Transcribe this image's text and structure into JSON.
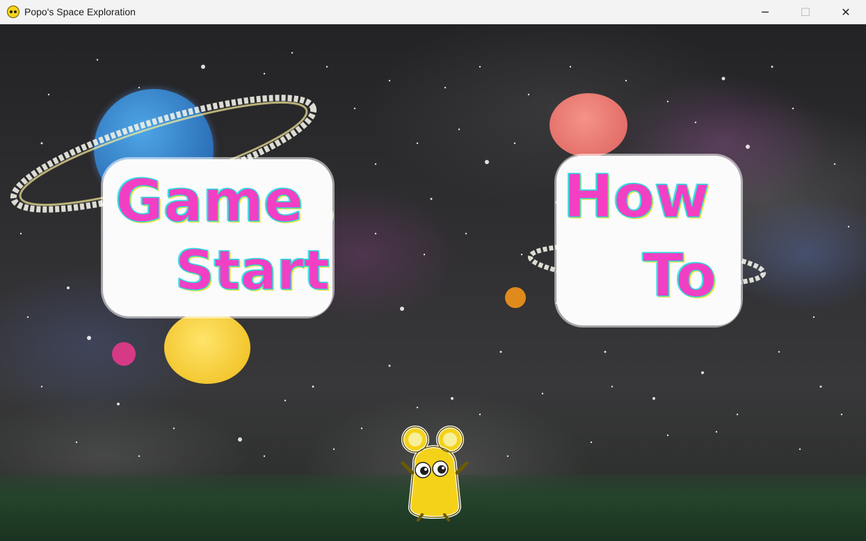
{
  "window": {
    "title": "Popo's Space Exploration",
    "app_icon": "popo-icon",
    "controls": {
      "minimize": "─",
      "maximize": "☐",
      "close": "✕"
    }
  },
  "menu": {
    "game_start": {
      "line1": "Game",
      "line2": "Start"
    },
    "how_to": {
      "line1": "How",
      "line2": "To"
    }
  },
  "colors": {
    "button_text": "#f23fc4",
    "button_outline": "#2fd8d8",
    "planet_blue": "#2c6fb8",
    "planet_yellow": "#f2c52c",
    "planet_red": "#e26e68",
    "character": "#f5d21a"
  }
}
